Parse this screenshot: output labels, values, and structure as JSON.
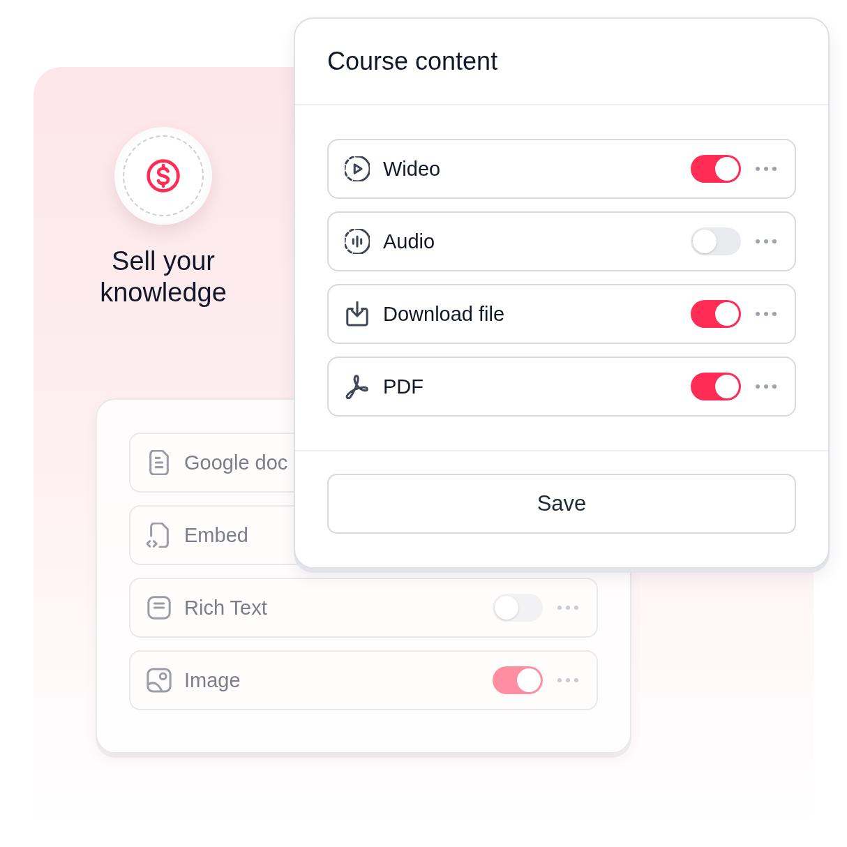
{
  "hero": {
    "title": "Sell your knowledge"
  },
  "library": {
    "items": [
      {
        "kind": "doc",
        "label": "Google doc"
      },
      {
        "kind": "embed",
        "label": "Embed"
      },
      {
        "kind": "rich_text",
        "label": "Rich Text",
        "on": false
      },
      {
        "kind": "image",
        "label": "Image",
        "on": true
      }
    ]
  },
  "panel": {
    "title": "Course content",
    "items": [
      {
        "kind": "video",
        "label": "Wideo",
        "on": true
      },
      {
        "kind": "audio",
        "label": "Audio",
        "on": false
      },
      {
        "kind": "download",
        "label": "Download file",
        "on": true
      },
      {
        "kind": "pdf",
        "label": "PDF",
        "on": true
      }
    ],
    "save_button": "Save"
  }
}
